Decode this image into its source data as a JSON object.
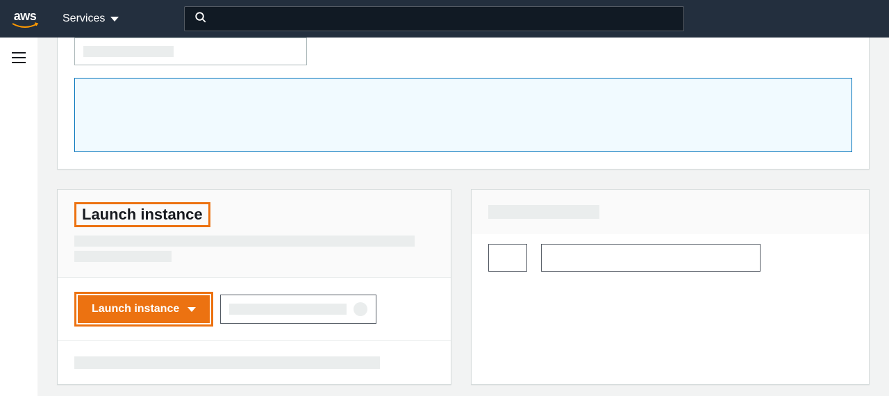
{
  "nav": {
    "services_label": "Services"
  },
  "launch_panel": {
    "title": "Launch instance",
    "button_label": "Launch instance"
  }
}
